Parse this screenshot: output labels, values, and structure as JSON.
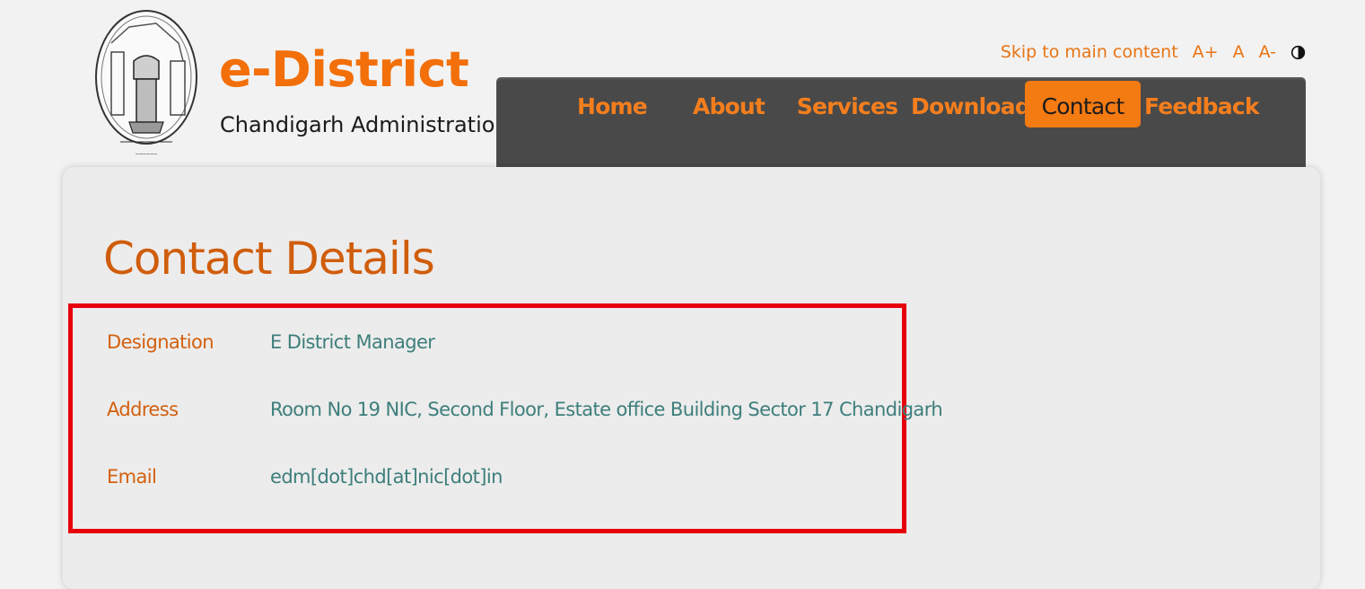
{
  "brand": {
    "title": "e-District",
    "subtitle": "Chandigarh Administration"
  },
  "utility": {
    "skip_link": "Skip to main content",
    "font_increase": "A+",
    "font_normal": "A",
    "font_decrease": "A-",
    "contrast_icon": "contrast-icon"
  },
  "nav": {
    "items": [
      {
        "label": "Home"
      },
      {
        "label": "About"
      },
      {
        "label": "Services"
      },
      {
        "label": "Downloads"
      },
      {
        "label": "Contact",
        "active": true
      },
      {
        "label": "Feedback"
      }
    ]
  },
  "page": {
    "title": "Contact Details"
  },
  "contact": {
    "rows": [
      {
        "label": "Designation",
        "value": "E District Manager"
      },
      {
        "label": "Address",
        "value": "Room No 19 NIC, Second Floor, Estate office Building Sector 17 Chandigarh"
      },
      {
        "label": "Email",
        "value": "edm[dot]chd[at]nic[dot]in"
      }
    ]
  },
  "colors": {
    "accent": "#f47a12",
    "nav_bg": "#494949",
    "label": "#d4600e",
    "value": "#3d7e7b",
    "highlight_border": "#e8000c"
  }
}
